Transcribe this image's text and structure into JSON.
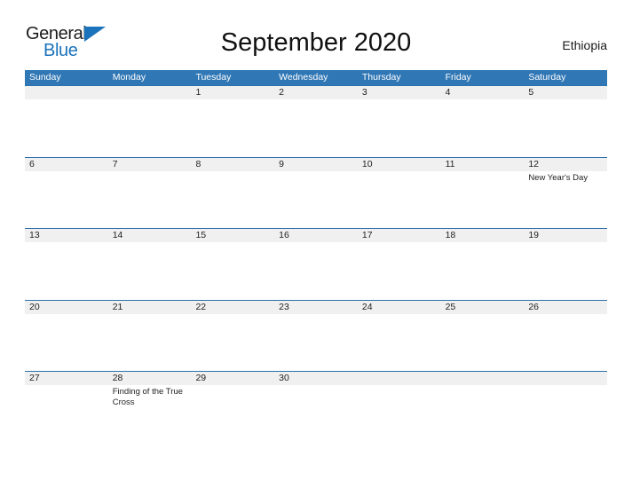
{
  "brand": {
    "name_part1": "General",
    "name_part2": "Blue",
    "flag_icon": "blue-triangle-flag"
  },
  "header": {
    "title": "September 2020",
    "country": "Ethiopia"
  },
  "calendar": {
    "weekdays": [
      "Sunday",
      "Monday",
      "Tuesday",
      "Wednesday",
      "Thursday",
      "Friday",
      "Saturday"
    ],
    "colors": {
      "header_blue": "#3077b5",
      "row_divider_blue": "#2f6fad",
      "day_band_gray": "#f0f0f0",
      "brand_blue": "#1b73bb"
    },
    "weeks": [
      [
        {
          "date": "",
          "event": ""
        },
        {
          "date": "",
          "event": ""
        },
        {
          "date": "1",
          "event": ""
        },
        {
          "date": "2",
          "event": ""
        },
        {
          "date": "3",
          "event": ""
        },
        {
          "date": "4",
          "event": ""
        },
        {
          "date": "5",
          "event": ""
        }
      ],
      [
        {
          "date": "6",
          "event": ""
        },
        {
          "date": "7",
          "event": ""
        },
        {
          "date": "8",
          "event": ""
        },
        {
          "date": "9",
          "event": ""
        },
        {
          "date": "10",
          "event": ""
        },
        {
          "date": "11",
          "event": ""
        },
        {
          "date": "12",
          "event": "New Year's Day"
        }
      ],
      [
        {
          "date": "13",
          "event": ""
        },
        {
          "date": "14",
          "event": ""
        },
        {
          "date": "15",
          "event": ""
        },
        {
          "date": "16",
          "event": ""
        },
        {
          "date": "17",
          "event": ""
        },
        {
          "date": "18",
          "event": ""
        },
        {
          "date": "19",
          "event": ""
        }
      ],
      [
        {
          "date": "20",
          "event": ""
        },
        {
          "date": "21",
          "event": ""
        },
        {
          "date": "22",
          "event": ""
        },
        {
          "date": "23",
          "event": ""
        },
        {
          "date": "24",
          "event": ""
        },
        {
          "date": "25",
          "event": ""
        },
        {
          "date": "26",
          "event": ""
        }
      ],
      [
        {
          "date": "27",
          "event": ""
        },
        {
          "date": "28",
          "event": "Finding of the True Cross"
        },
        {
          "date": "29",
          "event": ""
        },
        {
          "date": "30",
          "event": ""
        },
        {
          "date": "",
          "event": ""
        },
        {
          "date": "",
          "event": ""
        },
        {
          "date": "",
          "event": ""
        }
      ]
    ]
  }
}
